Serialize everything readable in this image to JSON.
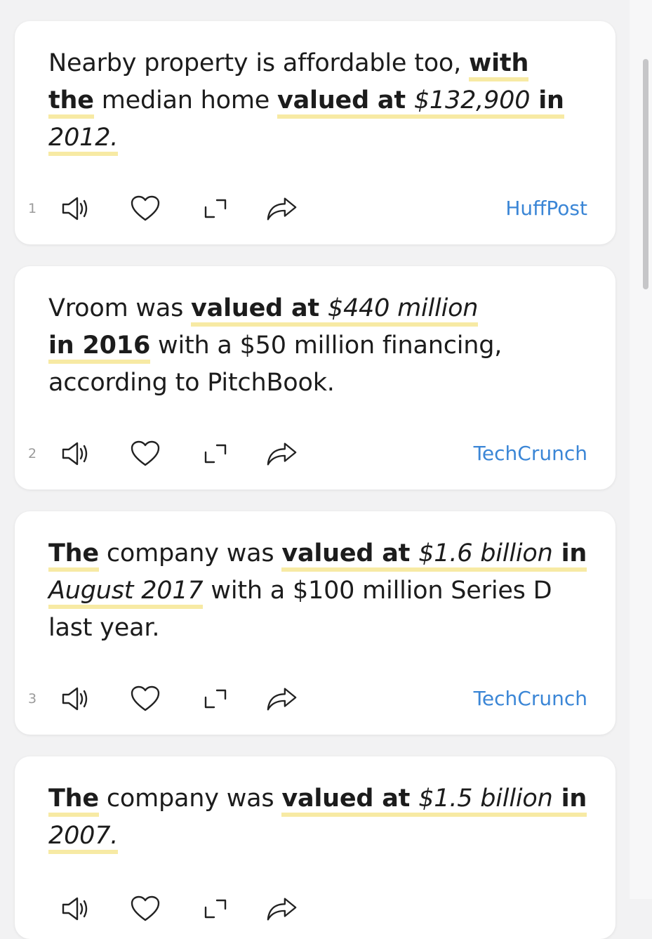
{
  "cards": [
    {
      "number": "1",
      "source": "HuffPost",
      "parts": [
        "Nearby property is affordable too, ",
        "with the",
        " median home ",
        "valued at ",
        "$132,900",
        " in ",
        "2012."
      ]
    },
    {
      "number": "2",
      "source": "TechCrunch",
      "parts": [
        "Vroom was ",
        "valued at ",
        "$440 million",
        " in 2016",
        " with a $50 million financing, according to PitchBook."
      ]
    },
    {
      "number": "3",
      "source": "TechCrunch",
      "parts": [
        "The",
        " company was ",
        "valued at ",
        "$1.6 billion",
        " in ",
        "August 2017",
        " with a $100 million Series D last year."
      ]
    },
    {
      "number": "",
      "source": "",
      "parts": [
        "The",
        " company was ",
        "valued at ",
        "$1.5 billion",
        " in ",
        "2007."
      ]
    }
  ],
  "icons": {
    "speaker": "speaker-icon",
    "heart": "heart-icon",
    "expand": "expand-icon",
    "share": "share-icon"
  },
  "colors": {
    "highlight": "#f7eaa4",
    "source_link": "#3b86d6",
    "background": "#f2f2f3"
  }
}
